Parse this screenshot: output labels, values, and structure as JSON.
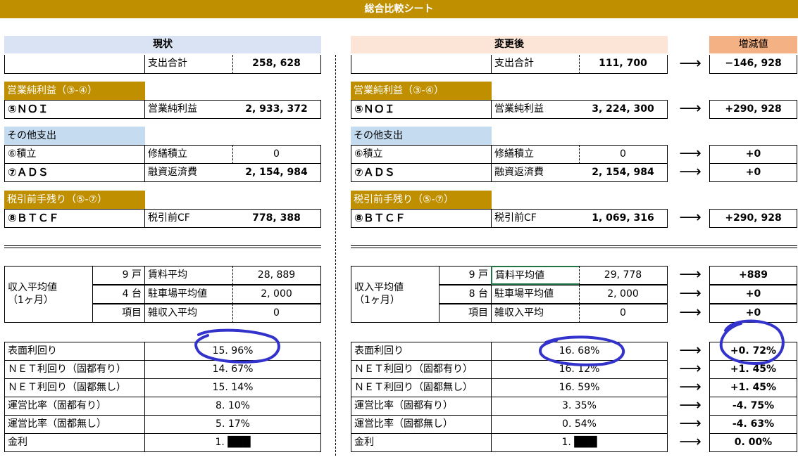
{
  "title": "総合比較シート",
  "headers": {
    "current": "現状",
    "after": "変更後",
    "diff": "増減値"
  },
  "row_expense": {
    "label": "支出合計",
    "current": "258, 628",
    "after": "111, 700",
    "diff": "−146, 928"
  },
  "noi": {
    "section": "営業純利益（③-④）",
    "name": "⑤ＮＯＩ",
    "label": "営業純利益",
    "current": "2, 933, 372",
    "after": "3, 224, 300",
    "diff": "+290, 928"
  },
  "other": {
    "section": "その他支出",
    "reserve": {
      "name": "⑥積立",
      "label": "修繕積立",
      "current": "0",
      "after": "0",
      "diff": "+0"
    },
    "ads": {
      "name": "⑦ＡＤＳ",
      "label": "融資返済費",
      "current": "2, 154, 984",
      "after": "2, 154, 984",
      "diff": "+0"
    }
  },
  "btcf": {
    "section": "税引前手残り（⑤-⑦）",
    "name": "⑧ＢＴＣＦ",
    "label": "税引前CF",
    "current": "778, 388",
    "after": "1, 069, 316",
    "diff": "+290, 928"
  },
  "income": {
    "group_label": "収入平均値",
    "group_sub": "（1ヶ月）",
    "current_rows": [
      {
        "count": "9 戸",
        "label": "賃料平均",
        "value": "28, 889"
      },
      {
        "count": "4 台",
        "label": "駐車場平均値",
        "value": "2, 000"
      },
      {
        "count": "項目",
        "label": "雑収入平均",
        "value": "0"
      }
    ],
    "after_rows": [
      {
        "count": "9 戸",
        "label": "賃料平均値",
        "value": "29, 778"
      },
      {
        "count": "8 台",
        "label": "駐車場平均値",
        "value": "2, 000"
      },
      {
        "count": "項目",
        "label": "雑収入平均",
        "value": "0"
      }
    ],
    "diffs": [
      "+889",
      "+0",
      "+0"
    ]
  },
  "ratios": [
    {
      "label": "表面利回り",
      "current": "15. 96%",
      "after": "16. 68%",
      "diff": "+0. 72%"
    },
    {
      "label": "ＮＥＴ利回り（固都有り）",
      "current": "14. 67%",
      "after": "16. 12%",
      "diff": "+1. 45%"
    },
    {
      "label": "ＮＥＴ利回り（固都無し）",
      "current": "15. 14%",
      "after": "16. 59%",
      "diff": "+1. 45%"
    },
    {
      "label": "運営比率（固都有り）",
      "current": "8. 10%",
      "after": "3. 35%",
      "diff": "-4. 75%"
    },
    {
      "label": "運営比率（固都無し）",
      "current": "5. 17%",
      "after": "0. 54%",
      "diff": "-4. 63%"
    },
    {
      "label": "金利",
      "current": "1. ███",
      "after": "1. ███",
      "diff": "0. 00%"
    }
  ],
  "arrow": "⟶",
  "colors": {
    "banner": "#bf8f00",
    "current_header": "#dae3f3",
    "after_header": "#fce4d6",
    "diff_header": "#f4b183",
    "section_blue": "#c5dbf0",
    "annotation": "#3333cc"
  },
  "icons": {
    "arrow": "right-arrow-icon"
  }
}
